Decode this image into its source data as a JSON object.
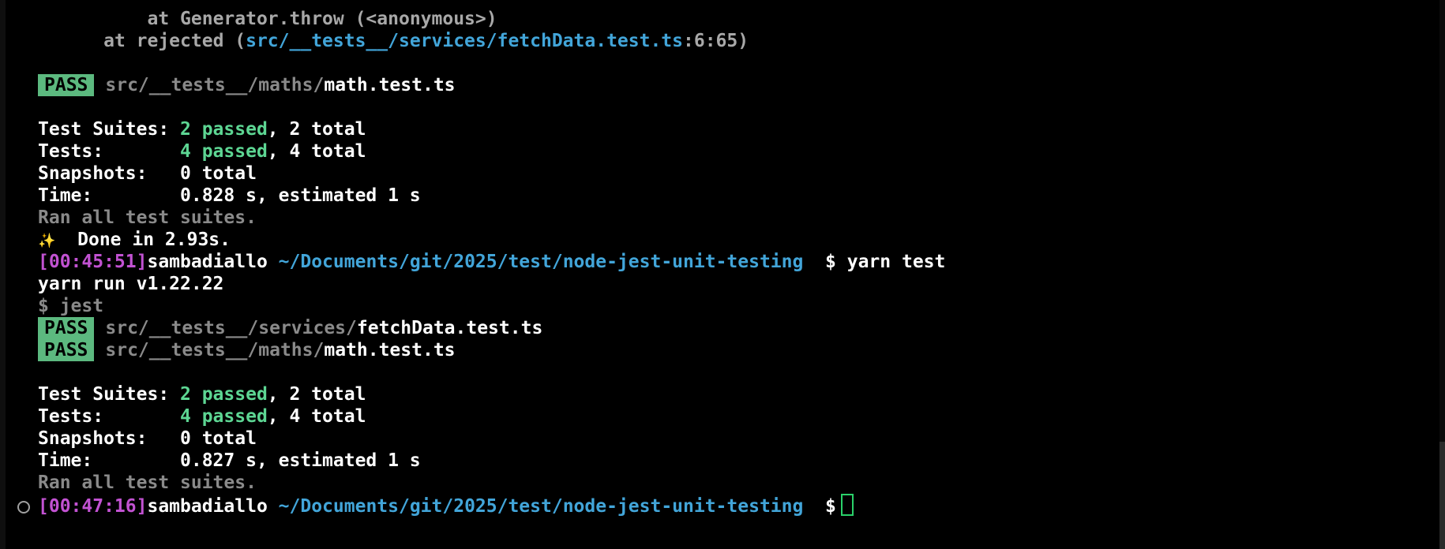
{
  "colors": {
    "background": "#000000",
    "pass_badge": "#5cb97f",
    "passed_text": "#5dd693",
    "path": "#42a5d9",
    "timestamp": "#c252d2",
    "cursor": "#2ad16a"
  },
  "stack": {
    "line1": "at Generator.throw (<anonymous>)",
    "line2_prefix": "at rejected (",
    "line2_path": "src/__tests__/services/fetchData.test.ts",
    "line2_pos": ":6:65)"
  },
  "run1": {
    "pass_label": "PASS",
    "file_dir": "src/__tests__/maths/",
    "file_name": "math.test.ts",
    "suites_label": "Test Suites: ",
    "suites_passed": "2 passed",
    "suites_total": ", 2 total",
    "tests_label": "Tests:       ",
    "tests_passed": "4 passed",
    "tests_total": ", 4 total",
    "snapshots": "Snapshots:   0 total",
    "time": "Time:        0.828 s, estimated 1 s",
    "ran_all": "Ran all test suites.",
    "sparkle_icon": "✨",
    "done": "Done in 2.93s."
  },
  "prompt1": {
    "timestamp": "[00:45:51]",
    "user": "sambadiallo",
    "path": "~/Documents/git/2025/test/node-jest-unit-testing",
    "command": "$ yarn test"
  },
  "run2": {
    "yarn_version": "yarn run v1.22.22",
    "jest_cmd": "$ jest",
    "pass_label": "PASS",
    "file1_dir": "src/__tests__/services/",
    "file1_name": "fetchData.test.ts",
    "file2_dir": "src/__tests__/maths/",
    "file2_name": "math.test.ts",
    "suites_label": "Test Suites: ",
    "suites_passed": "2 passed",
    "suites_total": ", 2 total",
    "tests_label": "Tests:       ",
    "tests_passed": "4 passed",
    "tests_total": ", 4 total",
    "snapshots": "Snapshots:   0 total",
    "time": "Time:        0.827 s, estimated 1 s",
    "ran_all": "Ran all test suites."
  },
  "prompt2": {
    "timestamp": "[00:47:16]",
    "user": "sambadiallo",
    "path": "~/Documents/git/2025/test/node-jest-unit-testing",
    "dollar": "$"
  }
}
